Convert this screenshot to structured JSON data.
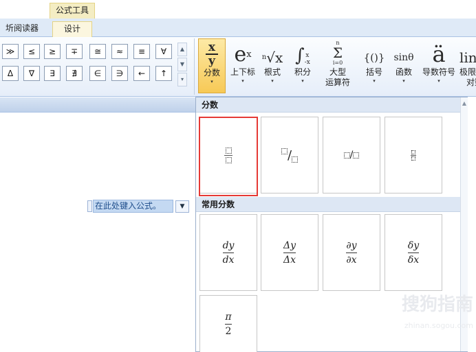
{
  "context_tab": "公式工具",
  "tabs": [
    "圻阅读器",
    "设计"
  ],
  "symbols_row1": [
    "≫",
    "≤",
    "≥",
    "∓",
    "≅",
    "≈",
    "≡",
    "∀"
  ],
  "symbols_row2": [
    "Δ",
    "∇",
    "∃",
    "∄",
    "∈",
    "∋",
    "←",
    "↑"
  ],
  "structures": [
    {
      "glyph": "x/y",
      "label": "分数"
    },
    {
      "glyph": "eˣ",
      "label": "上下标"
    },
    {
      "glyph": "ⁿ√x",
      "label": "根式"
    },
    {
      "glyph": "∫",
      "label": "积分"
    },
    {
      "glyph": "Σ",
      "label": "大型",
      "label2": "运算符"
    },
    {
      "glyph": "{()}",
      "label": "括号"
    },
    {
      "glyph": "sinθ",
      "label": "函数"
    },
    {
      "glyph": "ä",
      "label": "导数符号"
    },
    {
      "glyph": "lin",
      "label": "极限",
      "label2": "对数"
    }
  ],
  "equation_placeholder": "在此处键入公式。",
  "gallery": {
    "section1_title": "分数",
    "section2_title": "常用分数",
    "common": [
      {
        "num": "dy",
        "den": "dx"
      },
      {
        "num": "Δy",
        "den": "Δx"
      },
      {
        "num": "∂y",
        "den": "∂x"
      },
      {
        "num": "δy",
        "den": "δx"
      },
      {
        "num": "π",
        "den": "2"
      }
    ]
  },
  "watermark": "搜狗指南",
  "watermark_sub": "zhinan.sogou.com"
}
